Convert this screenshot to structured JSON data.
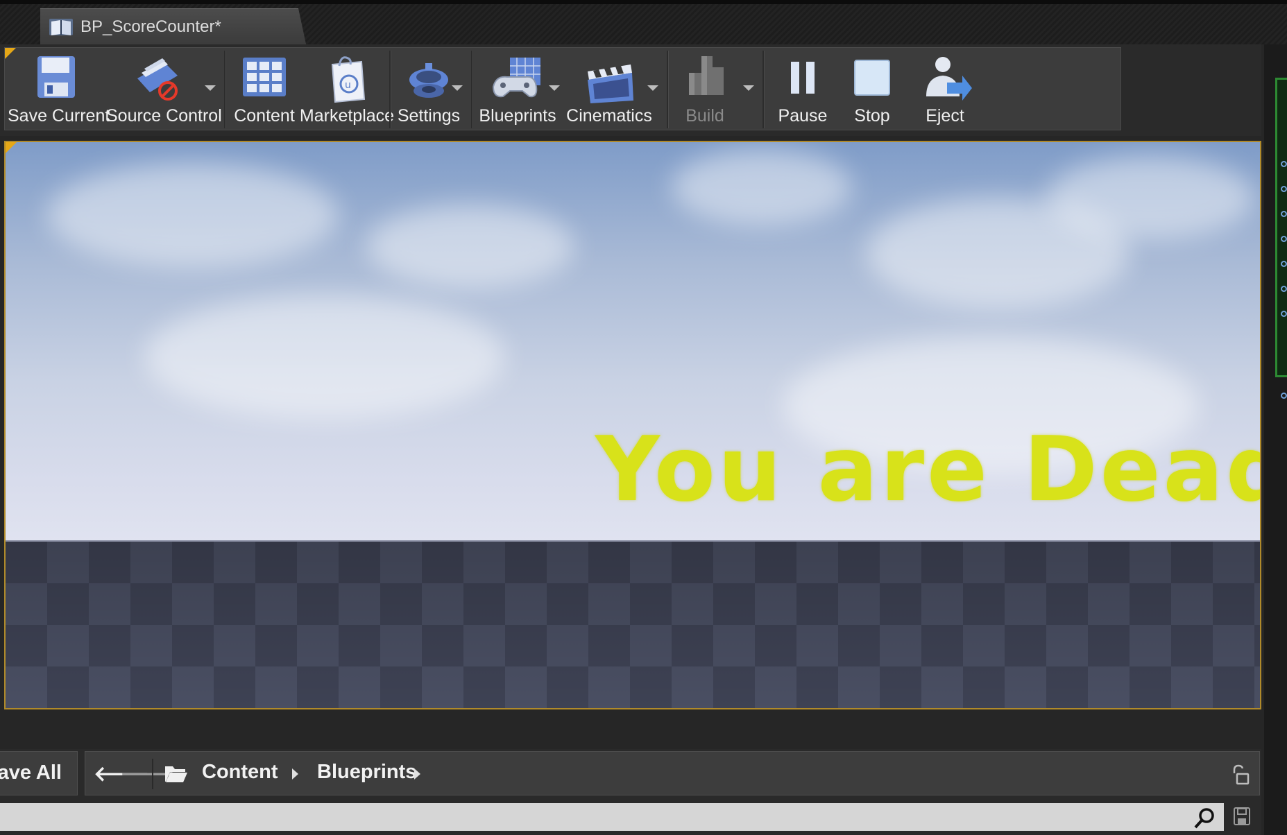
{
  "document_tab": {
    "title": "BP_ScoreCounter*",
    "close": "×",
    "icon": "blueprint-book-icon"
  },
  "toolbar": {
    "save_current": "Save Current",
    "source_control": "Source Control",
    "content": "Content",
    "marketplace": "Marketplace",
    "settings": "Settings",
    "blueprints": "Blueprints",
    "cinematics": "Cinematics",
    "build": "Build",
    "pause": "Pause",
    "stop": "Stop",
    "eject": "Eject"
  },
  "viewport": {
    "message": "You are Dead!",
    "message_color": "#d8e21a",
    "border_color": "#b08a2a"
  },
  "content_browser": {
    "save_all": "ave All",
    "back": "🡐",
    "forward": "🡒",
    "path": [
      "Content",
      "Blueprints"
    ],
    "search": {
      "value": "",
      "placeholder": ""
    }
  },
  "colors": {
    "accent": "#e6a817",
    "panel_green": "#2d8a33"
  }
}
